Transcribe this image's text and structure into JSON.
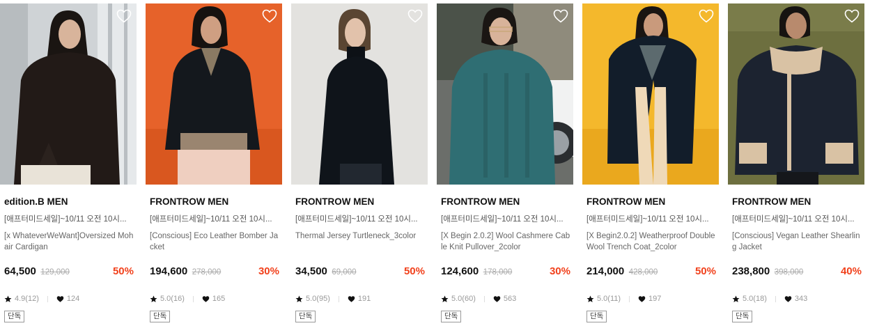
{
  "products": [
    {
      "brand": "edition.B MEN",
      "promo": "[애프터미드세일]~10/11 오전 10시...",
      "name": "[x WhateverWeWant]Oversized Mohair Cardigan",
      "price": "64,500",
      "original_price": "129,000",
      "discount": "50%",
      "rating": "4.9(12)",
      "likes": "124",
      "badge": "단독",
      "image_subject": "man-dark-mohair-cardigan"
    },
    {
      "brand": "FRONTROW MEN",
      "promo": "[애프터미드세일]~10/11 오전 10시...",
      "name": "[Conscious] Eco Leather Bomber Jacket",
      "price": "194,600",
      "original_price": "278,000",
      "discount": "30%",
      "rating": "5.0(16)",
      "likes": "165",
      "badge": "단독",
      "image_subject": "man-black-leather-bomber-orange-backdrop"
    },
    {
      "brand": "FRONTROW MEN",
      "promo": "[애프터미드세일]~10/11 오전 10시...",
      "name": "Thermal Jersey Turtleneck_3color",
      "price": "34,500",
      "original_price": "69,000",
      "discount": "50%",
      "rating": "5.0(95)",
      "likes": "191",
      "badge": "단독",
      "image_subject": "man-black-turtleneck-grey-backdrop"
    },
    {
      "brand": "FRONTROW MEN",
      "promo": "[애프터미드세일]~10/11 오전 10시...",
      "name": "[X Begin 2.0.2] Wool Cashmere Cable Knit Pullover_2color",
      "price": "124,600",
      "original_price": "178,000",
      "discount": "30%",
      "rating": "5.0(60)",
      "likes": "563",
      "badge": "단독",
      "image_subject": "man-teal-cable-knit-outdoor"
    },
    {
      "brand": "FRONTROW MEN",
      "promo": "[애프터미드세일]~10/11 오전 10시...",
      "name": "[X Begin2.0.2] Weatherproof Double Wool Trench Coat_2color",
      "price": "214,000",
      "original_price": "428,000",
      "discount": "50%",
      "rating": "5.0(11)",
      "likes": "197",
      "badge": "단독",
      "image_subject": "man-navy-trench-coat-yellow-backdrop"
    },
    {
      "brand": "FRONTROW MEN",
      "promo": "[애프터미드세일]~10/11 오전 10시...",
      "name": "[Conscious] Vegan Leather Shearling Jacket",
      "price": "238,800",
      "original_price": "398,000",
      "discount": "40%",
      "rating": "5.0(18)",
      "likes": "343",
      "badge": "단독",
      "image_subject": "man-shearling-jacket-olive-backdrop"
    }
  ],
  "colors": {
    "discount": "#f1411c",
    "brand_text": "#111111",
    "muted_text": "#999999"
  },
  "icons": {
    "wishlist": "heart-outline-icon",
    "rating": "star-icon",
    "likes": "heart-filled-icon"
  }
}
